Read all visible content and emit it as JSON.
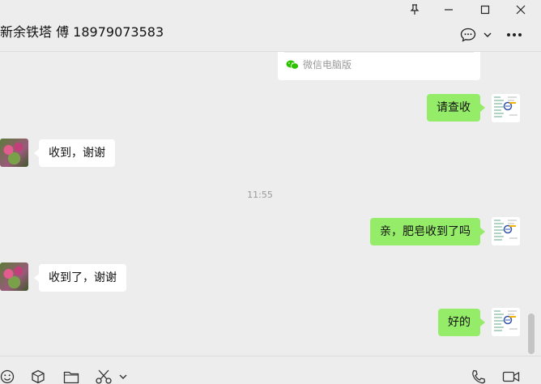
{
  "header": {
    "chat_title": "新余铁塔 傅 18979073583"
  },
  "window_controls": [
    "pin-icon",
    "minimize-icon",
    "maximize-icon",
    "close-icon"
  ],
  "header_icons": [
    "chat-bubble-icon",
    "chevron-down-icon",
    "more-icon"
  ],
  "card": {
    "source_label": "微信电脑版",
    "source_icon": "wechat-logo-icon",
    "source_color": "#2dc100"
  },
  "messages": [
    {
      "side": "me",
      "text": "请查收"
    },
    {
      "side": "other",
      "text": "收到，谢谢"
    },
    {
      "side": "time",
      "text": "11:55"
    },
    {
      "side": "me",
      "text": "亲，肥皂收到了吗"
    },
    {
      "side": "other",
      "text": "收到了，谢谢"
    },
    {
      "side": "me",
      "text": "好的"
    }
  ],
  "toolbar": {
    "left": [
      "emoji-icon",
      "sticker-box-icon",
      "folder-icon",
      "scissors-icon",
      "chevron-down-icon"
    ],
    "right": [
      "phone-icon",
      "video-icon"
    ]
  },
  "colors": {
    "my_bubble": "#95ec69",
    "other_bubble": "#ffffff",
    "background": "#ededed"
  }
}
